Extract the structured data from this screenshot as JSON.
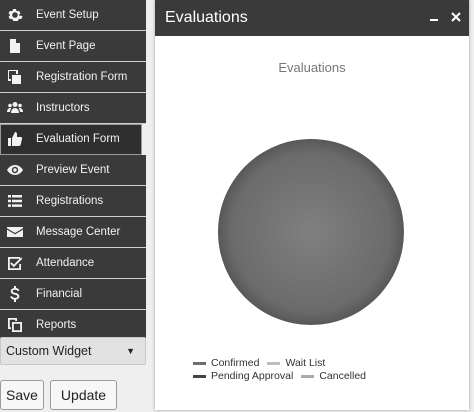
{
  "sidebar": {
    "items": [
      {
        "label": "Event Setup",
        "icon": "gear-icon"
      },
      {
        "label": "Event Page",
        "icon": "document-icon"
      },
      {
        "label": "Registration Form",
        "icon": "form-copy-icon"
      },
      {
        "label": "Instructors",
        "icon": "users-icon"
      },
      {
        "label": "Evaluation Form",
        "icon": "thumbs-up-icon"
      },
      {
        "label": "Preview Event",
        "icon": "eye-icon"
      },
      {
        "label": "Registrations",
        "icon": "list-icon"
      },
      {
        "label": "Message Center",
        "icon": "envelope-icon"
      },
      {
        "label": "Attendance",
        "icon": "checkbox-icon"
      },
      {
        "label": "Financial",
        "icon": "dollar-icon"
      },
      {
        "label": "Reports",
        "icon": "copy-icon"
      }
    ],
    "widget_select": {
      "value": "Custom Widget"
    }
  },
  "buttons": {
    "save": "Save",
    "update": "Update"
  },
  "panel": {
    "title": "Evaluations"
  },
  "chart_data": {
    "type": "pie",
    "title": "Evaluations",
    "categories": [
      "Confirmed",
      "Wait List",
      "Pending Approval",
      "Cancelled"
    ],
    "values": [
      1,
      0,
      0,
      0
    ],
    "colors": [
      "#6e6e6e",
      "#bdbdbd",
      "#444444",
      "#a9a9a9"
    ],
    "legend_placement": "bottom"
  },
  "colors": {
    "sidebar_bg": "#3a3a3a",
    "header_bg": "#3a3a3a",
    "page_bg": "#efefef"
  }
}
